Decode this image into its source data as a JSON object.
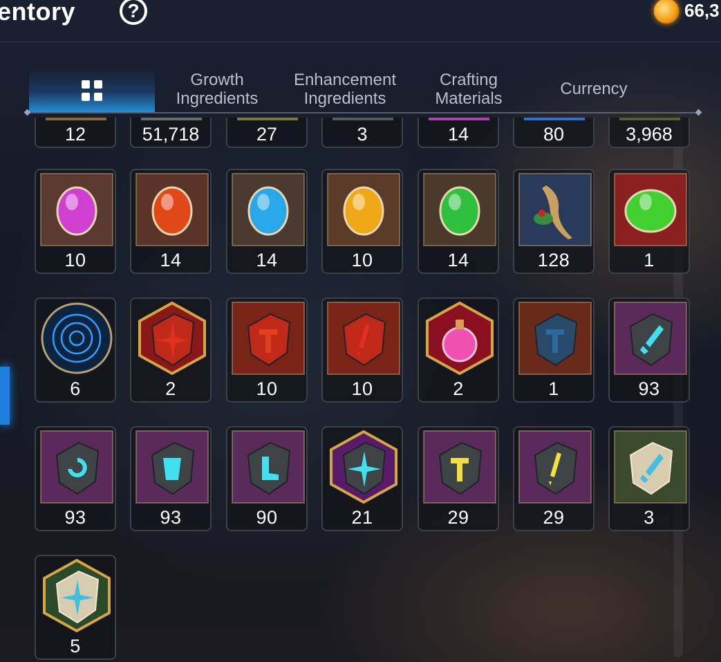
{
  "header": {
    "title": "entory",
    "help_icon": "question-circle-icon",
    "currency_icon": "gold-coin-icon",
    "currency_value": "66,3"
  },
  "tabs": [
    {
      "label": "",
      "icon": "grid-icon",
      "active": true
    },
    {
      "label_line1": "Growth",
      "label_line2": "Ingredients"
    },
    {
      "label_line1": "Enhancement",
      "label_line2": "Ingredients"
    },
    {
      "label_line1": "Crafting",
      "label_line2": "Materials"
    },
    {
      "label_line1": "Currency",
      "label_line2": ""
    }
  ],
  "partial_row": [
    "12",
    "51,718",
    "27",
    "3",
    "14",
    "80",
    "3,968"
  ],
  "partial_row_colors": [
    "#8a6a30",
    "#6a6a6a",
    "#7a7a40",
    "#5a5a5a",
    "#b040b0",
    "#3070d0",
    "#506030"
  ],
  "rows": [
    [
      {
        "icon": "purple-gem-icon",
        "count": "10",
        "bg": "#5a3a30",
        "gem": "#d040d0"
      },
      {
        "icon": "red-gem-icon",
        "count": "14",
        "bg": "#5a3428",
        "gem": "#e04818"
      },
      {
        "icon": "blue-gem-icon",
        "count": "14",
        "bg": "#4a3a30",
        "gem": "#28a8e8"
      },
      {
        "icon": "yellow-gem-icon",
        "count": "10",
        "bg": "#5a3a28",
        "gem": "#f0a818"
      },
      {
        "icon": "green-gem-icon",
        "count": "14",
        "bg": "#4a3a2c",
        "gem": "#30c040"
      },
      {
        "icon": "ginseng-root-icon",
        "count": "128",
        "bg": "#2a3a5a",
        "gem": "#c8a060"
      },
      {
        "icon": "green-potion-orb-icon",
        "count": "1",
        "bg": "#8a2020",
        "gem": "#40d030"
      }
    ],
    [
      {
        "icon": "blue-rune-disk-icon",
        "count": "6",
        "bg": "#0c2440",
        "gem": "#30a0ff"
      },
      {
        "icon": "red-sparkle-stone-icon",
        "count": "2",
        "bg": "#8a1818",
        "gem": "#e03020"
      },
      {
        "icon": "red-hammer-stone-icon",
        "count": "10",
        "bg": "#7a2418",
        "gem": "#e04020"
      },
      {
        "icon": "red-dagger-stone-icon",
        "count": "10",
        "bg": "#7a2418",
        "gem": "#e03020"
      },
      {
        "icon": "pink-potion-flask-icon",
        "count": "2",
        "bg": "#8a1020",
        "gem": "#f050b0"
      },
      {
        "icon": "blue-hammer-rune-icon",
        "count": "1",
        "bg": "#6a2a1a",
        "gem": "#2a6a9a"
      },
      {
        "icon": "sword-rune-stone-icon",
        "count": "93",
        "bg": "#5a2a5a",
        "gem": "#40e0f0"
      }
    ],
    [
      {
        "icon": "spiral-rune-stone-icon",
        "count": "93",
        "bg": "#5a2a5a",
        "gem": "#40e0f0"
      },
      {
        "icon": "armor-rune-stone-icon",
        "count": "93",
        "bg": "#5a2a5a",
        "gem": "#40e0f0"
      },
      {
        "icon": "boot-rune-stone-icon",
        "count": "90",
        "bg": "#5a2a5a",
        "gem": "#40e0f0"
      },
      {
        "icon": "sparkle-rune-stone-icon",
        "count": "21",
        "bg": "#5a1a6a",
        "gem": "#40e0f0"
      },
      {
        "icon": "yellow-hammer-stone-icon",
        "count": "29",
        "bg": "#5a2a5a",
        "gem": "#f0e040"
      },
      {
        "icon": "yellow-dagger-stone-icon",
        "count": "29",
        "bg": "#5a2a5a",
        "gem": "#f0e040"
      },
      {
        "icon": "white-sword-rune-icon",
        "count": "3",
        "bg": "#3a4a2a",
        "gem": "#40c0e0"
      }
    ],
    [
      {
        "icon": "white-sparkle-rune-icon",
        "count": "5",
        "bg": "#2a4a2a",
        "gem": "#40c0e0"
      }
    ]
  ]
}
